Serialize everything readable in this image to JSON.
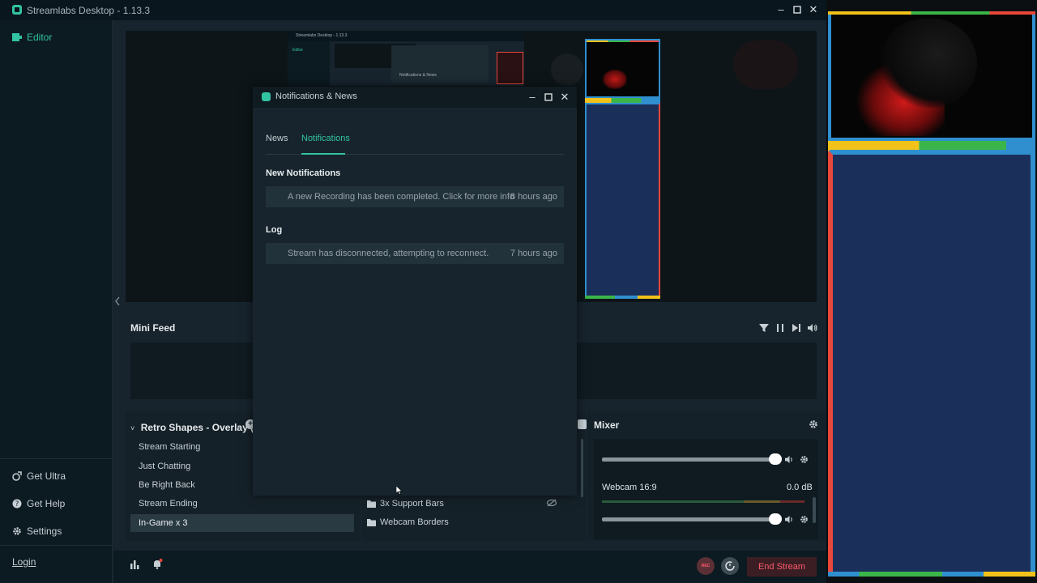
{
  "window": {
    "title": "Streamlabs Desktop - 1.13.3"
  },
  "sidebar": {
    "editor_label": "Editor",
    "get_ultra_label": "Get Ultra",
    "get_help_label": "Get Help",
    "settings_label": "Settings",
    "login_label": "Login"
  },
  "preview": {
    "inner_title": "Streamlabs Desktop - 1.13.3",
    "inner_editor": "Editor",
    "inner_dialog": "Notifications & News"
  },
  "mini_feed": {
    "title": "Mini Feed"
  },
  "scenes": {
    "collection_title": "Retro Shapes - Overlay (1)",
    "items": [
      "Stream Starting",
      "Just Chatting",
      "Be Right Back",
      "Stream Ending",
      "In-Game x 3"
    ],
    "active_index": 4
  },
  "sources": {
    "items": [
      "3x Support Bars",
      "Webcam Borders"
    ]
  },
  "mixer": {
    "title": "Mixer",
    "source_name": "Webcam 16:9",
    "source_level": "0.0 dB"
  },
  "footer": {
    "end_stream_label": "End Stream",
    "rec_label": "REC"
  },
  "dialog": {
    "title": "Notifications & News",
    "tabs": [
      "News",
      "Notifications"
    ],
    "active_tab": "Notifications",
    "new_section": "New Notifications",
    "new_items": [
      {
        "message": "A new Recording has been completed. Click for more info",
        "time": "8 hours ago"
      }
    ],
    "log_section": "Log",
    "log_items": [
      {
        "message": "Stream has disconnected, attempting to reconnect.",
        "time": "7 hours ago"
      }
    ]
  },
  "colors": {
    "accent": "#31c3a2",
    "yellow": "#f2c21b",
    "green": "#3bb54a",
    "blue": "#2f8fcf",
    "red": "#e8473b",
    "navy": "#1b2f5b",
    "end_stream": "#ff5a6a"
  },
  "icons": {
    "editor": "editor-icon",
    "ultra": "ultra-icon",
    "help": "help-icon",
    "settings": "gear-icon",
    "filter": "filter-icon",
    "pause": "pause-icon",
    "skip": "skip-icon",
    "volume": "volume-icon",
    "folder": "folder-icon",
    "eye_hidden": "eye-slash-icon",
    "stats": "stats-icon",
    "bell": "bell-icon",
    "replay": "replay-icon"
  }
}
